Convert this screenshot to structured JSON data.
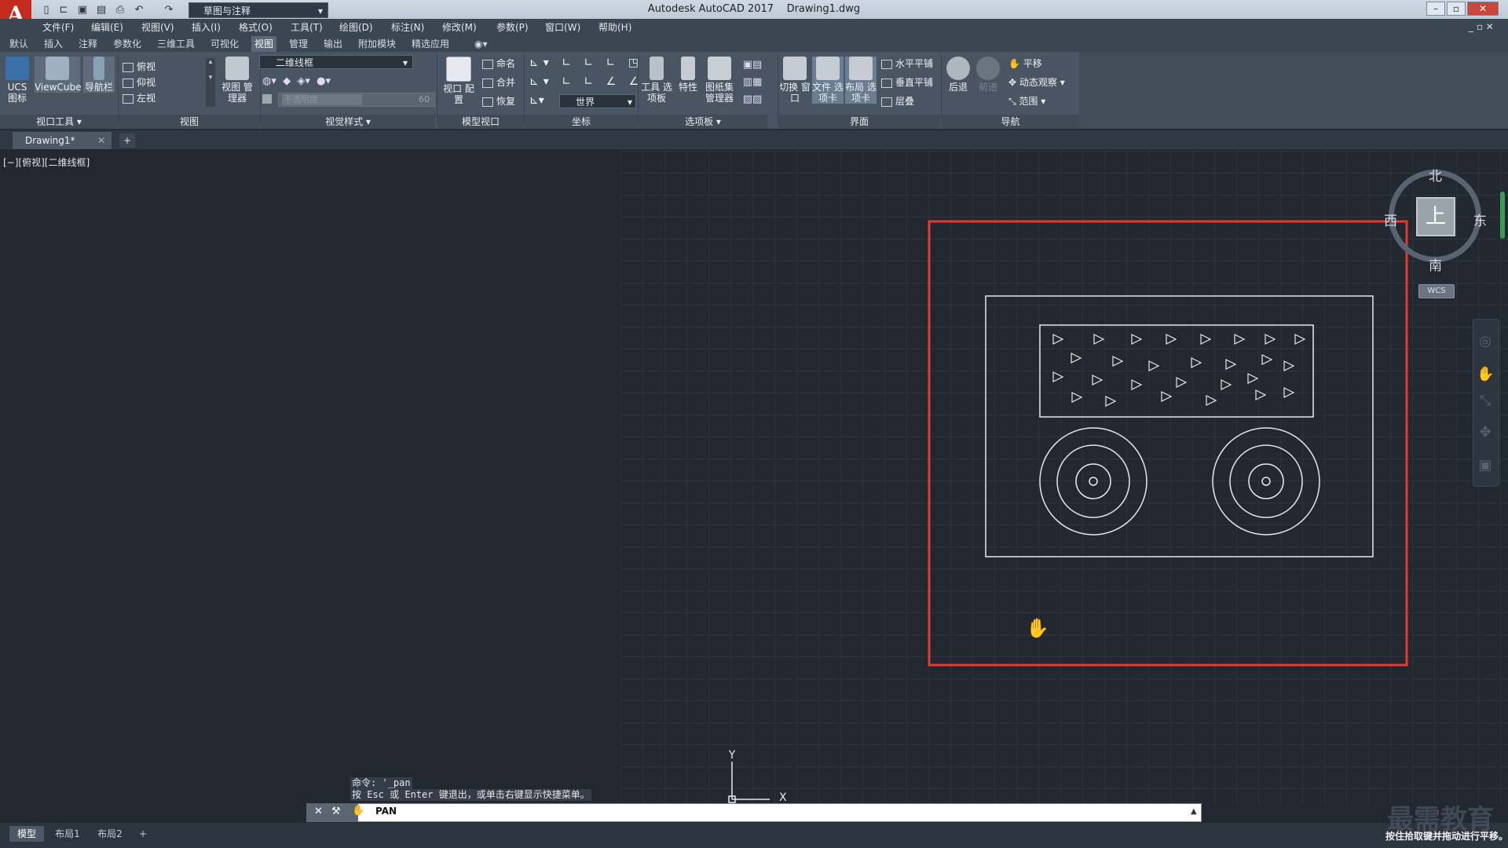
{
  "app": {
    "logo": "A",
    "title": "Autodesk AutoCAD 2017",
    "filename": "Drawing1.dwg",
    "workspace": "草图与注释"
  },
  "menu": [
    "文件(F)",
    "编辑(E)",
    "视图(V)",
    "插入(I)",
    "格式(O)",
    "工具(T)",
    "绘图(D)",
    "标注(N)",
    "修改(M)",
    "参数(P)",
    "窗口(W)",
    "帮助(H)"
  ],
  "ribbon_tabs": [
    "默认",
    "插入",
    "注释",
    "参数化",
    "三维工具",
    "可视化",
    "视图",
    "管理",
    "输出",
    "附加模块",
    "精选应用"
  ],
  "active_ribbon_tab": "视图",
  "ribbon": {
    "viewport_tools": {
      "ucs": "UCS 图标",
      "viewcube": "ViewCube",
      "navbar": "导航栏",
      "title": "视口工具"
    },
    "views": {
      "items": [
        "俯视",
        "仰视",
        "左视"
      ],
      "manager": "视图 管理器",
      "title": "视图"
    },
    "visual_styles": {
      "style": "二维线框",
      "opacity_placeholder": "不透明度",
      "opacity_value": "60",
      "title": "视觉样式"
    },
    "model_viewports": {
      "config": "视口 配置",
      "name": "命名",
      "join": "合并",
      "restore": "恢复",
      "title": "模型视口"
    },
    "coordinates": {
      "world": "世界",
      "title": "坐标"
    },
    "palettes": {
      "tool": "工具 选项板",
      "props": "特性",
      "sheetset": "图纸集 管理器",
      "title": "选项板"
    },
    "interface": {
      "switch": "切换 窗口",
      "filetabs": "文件 选项卡",
      "layouttabs": "布局 选项卡",
      "tile_h": "水平平铺",
      "tile_v": "垂直平铺",
      "cascade": "层叠",
      "title": "界面"
    },
    "navigate": {
      "back": "后退",
      "forward": "前进",
      "pan": "平移",
      "orbit": "动态观察",
      "extents": "范围",
      "title": "导航"
    }
  },
  "doc_tab": "Drawing1*",
  "view_label": "[−][俯视][二维线框]",
  "viewcube": {
    "north": "北",
    "south": "南",
    "east": "东",
    "west": "西",
    "face": "上",
    "wcs": "WCS"
  },
  "ucs": {
    "x": "X",
    "y": "Y"
  },
  "command": {
    "history": [
      "命令: '_pan",
      "按 Esc 或 Enter 键退出，或单击右键显示快捷菜单。"
    ],
    "input": "PAN"
  },
  "layout_tabs": [
    "模型",
    "布局1",
    "布局2"
  ],
  "status_text": "按住拾取键并拖动进行平移。",
  "watermark": "最需教育",
  "colors": {
    "highlight": "#e53a30",
    "canvas": "#212830"
  }
}
